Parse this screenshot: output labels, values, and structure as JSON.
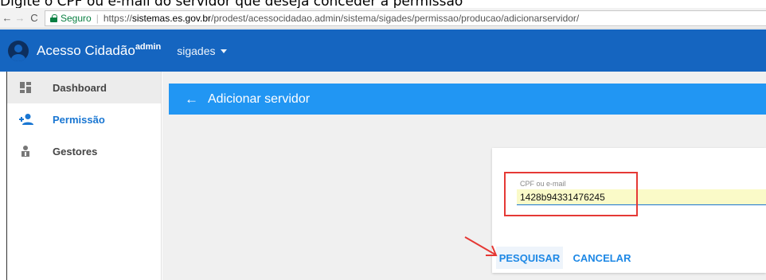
{
  "caption": "Digite o CPF ou e-mail do servidor que deseja conceder a permissão",
  "browser": {
    "back": "←",
    "forward": "→",
    "reload": "C",
    "secure_label": "Seguro",
    "url_prefix": "https://",
    "url_domain": "sistemas.es.gov.br",
    "url_path": "/prodest/acessocidadao.admin/sistema/sigades/permissao/producao/adicionarservidor/"
  },
  "header": {
    "title": "Acesso Cidadão",
    "title_sup": "admin",
    "system": "sigades"
  },
  "sidebar": {
    "items": [
      {
        "label": "Dashboard",
        "icon": "dashboard-icon"
      },
      {
        "label": "Permissão",
        "icon": "add-person-icon"
      },
      {
        "label": "Gestores",
        "icon": "manager-icon"
      }
    ]
  },
  "page": {
    "back_icon": "←",
    "title": "Adicionar servidor"
  },
  "form": {
    "field_label": "CPF ou e-mail",
    "field_value": "1428b94331476245",
    "search_button": "PESQUISAR",
    "cancel_button": "CANCELAR"
  },
  "colors": {
    "header": "#1565c0",
    "page_bar": "#2196f3",
    "accent": "#1e88e5",
    "highlight": "#e53935"
  }
}
